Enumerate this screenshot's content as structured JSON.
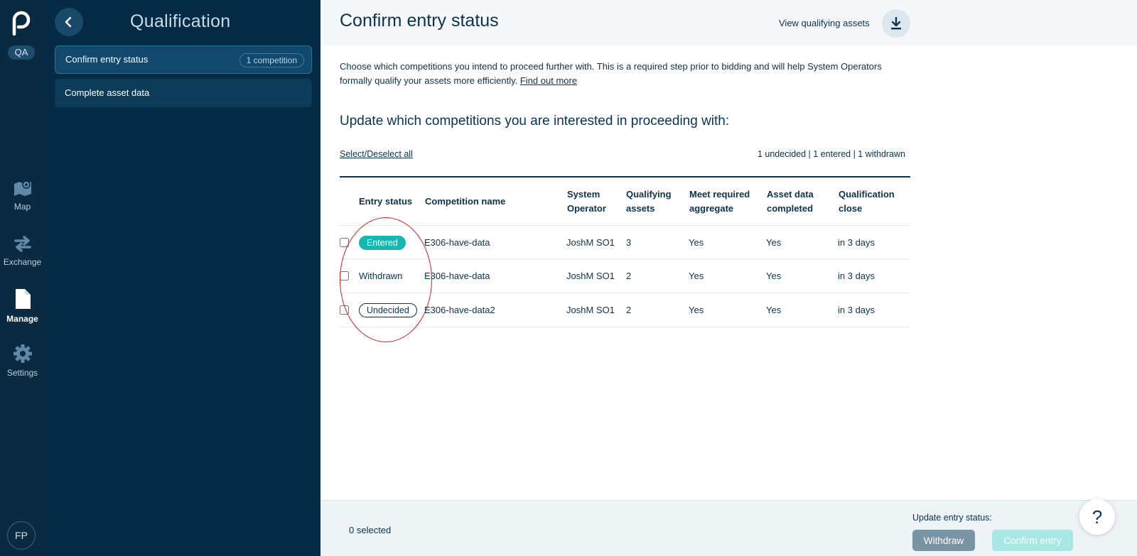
{
  "rail": {
    "env_badge": "QA",
    "items": [
      {
        "label": "Map",
        "icon": "map-icon"
      },
      {
        "label": "Exchange",
        "icon": "exchange-icon"
      },
      {
        "label": "Manage",
        "icon": "document-icon"
      },
      {
        "label": "Settings",
        "icon": "gear-icon"
      }
    ],
    "avatar_initials": "FP"
  },
  "subnav": {
    "title": "Qualification",
    "items": [
      {
        "label": "Confirm entry status",
        "badge": "1 competition"
      },
      {
        "label": "Complete asset data"
      }
    ]
  },
  "main": {
    "title": "Confirm entry status",
    "view_assets_link": "View qualifying assets",
    "intro_text": "Choose which competitions you intend to proceed further with.",
    "intro_strong": " This is a required step prior to bidding and will help System Operators formally qualify your assets more efficiently.",
    "intro_link": "Find out more",
    "section_title": "Update which competitions you are interested in proceeding with:",
    "select_all": "Select/Deselect all",
    "summary": "1 undecided | 1 entered | 1 withdrawn",
    "table": {
      "headers": {
        "entry_status": "Entry status",
        "competition": "Competition name",
        "operator": "System Operator",
        "qual_assets": "Qualifying assets",
        "aggregate": "Meet required aggregate",
        "asset_data": "Asset data completed",
        "close": "Qualification close"
      },
      "rows": [
        {
          "status": "Entered",
          "competition": "E306-have-data",
          "operator": "JoshM SO1",
          "qual_assets": "3",
          "aggregate": "Yes",
          "asset_data": "Yes",
          "close": "in 3 days"
        },
        {
          "status": "Withdrawn",
          "competition": "E306-have-data",
          "operator": "JoshM SO1",
          "qual_assets": "2",
          "aggregate": "Yes",
          "asset_data": "Yes",
          "close": "in 3 days"
        },
        {
          "status": "Undecided",
          "competition": "E306-have-data2",
          "operator": "JoshM SO1",
          "qual_assets": "2",
          "aggregate": "Yes",
          "asset_data": "Yes",
          "close": "in 3 days"
        }
      ]
    }
  },
  "footer": {
    "selected_count": "0 selected",
    "update_label": "Update entry status:",
    "withdraw_label": "Withdraw",
    "confirm_label": "Confirm entry"
  },
  "help": {
    "label": "?"
  },
  "colors": {
    "rail_bg": "#0a2a42",
    "subnav_bg": "#062c45",
    "text": "#0b3350",
    "entered_teal": "#13b8b0",
    "annotation_red": "#e01a1a"
  }
}
